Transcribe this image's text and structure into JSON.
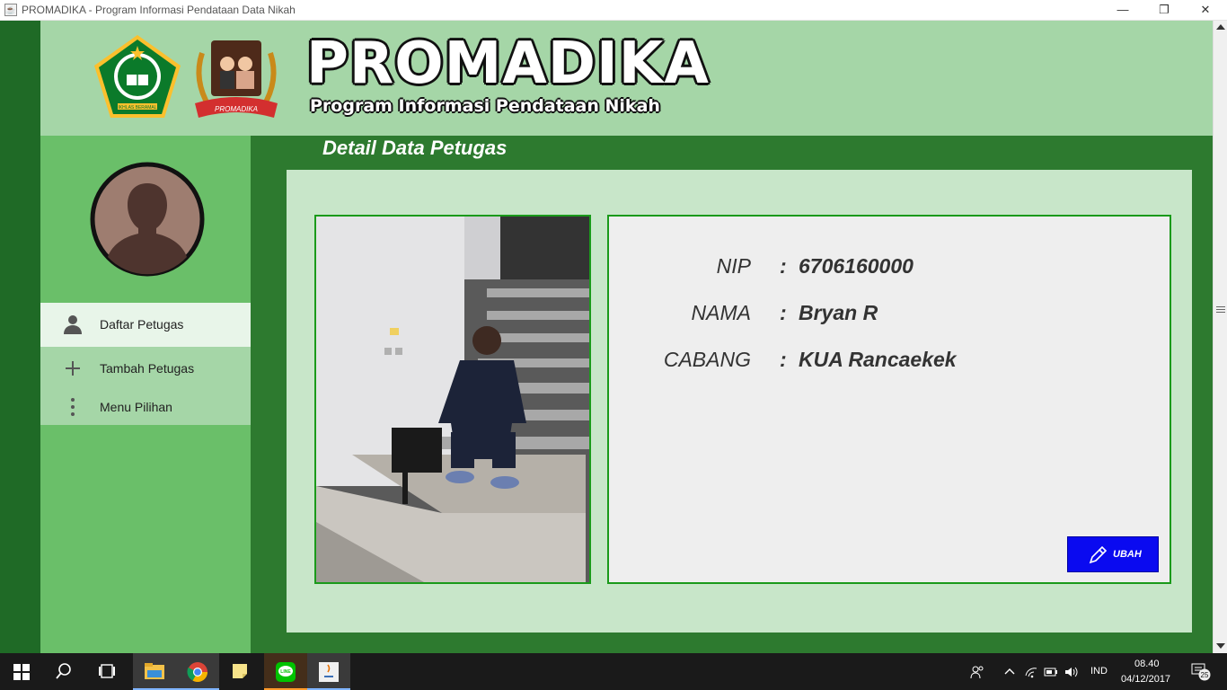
{
  "window": {
    "title": "PROMADIKA - Program Informasi Pendataan Data Nikah",
    "minimize": "—",
    "maximize": "❐",
    "close": "✕"
  },
  "header": {
    "brand_title": "PROMADIKA",
    "brand_subtitle": "Program Informasi Pendataan Nikah",
    "logo_left_caption": "IKHLAS BERAMAL",
    "logo_right_caption": "PROMADIKA"
  },
  "sidebar": {
    "items": [
      {
        "label": "Daftar Petugas",
        "icon": "user-icon",
        "active": true
      },
      {
        "label": "Tambah Petugas",
        "icon": "plus-icon",
        "active": false
      },
      {
        "label": "Menu Pilihan",
        "icon": "more-vertical-icon",
        "active": false
      }
    ]
  },
  "content": {
    "title": "Detail Data Petugas",
    "fields": [
      {
        "label": "NIP",
        "separator": ":",
        "value": "6706160000"
      },
      {
        "label": "NAMA",
        "separator": ":",
        "value": "Bryan R"
      },
      {
        "label": "CABANG",
        "separator": ":",
        "value": "KUA Rancaekek"
      }
    ],
    "edit_button": "UBAH"
  },
  "taskbar": {
    "language": "IND",
    "time": "08.40",
    "date": "04/12/2017",
    "notification_count": "25"
  },
  "colors": {
    "header_bg": "#a5d6a7",
    "sidebar_bg": "#6abf69",
    "app_bg": "#2d7a2f",
    "content_bg": "#c8e6c9",
    "button_bg": "#0a0af0"
  }
}
